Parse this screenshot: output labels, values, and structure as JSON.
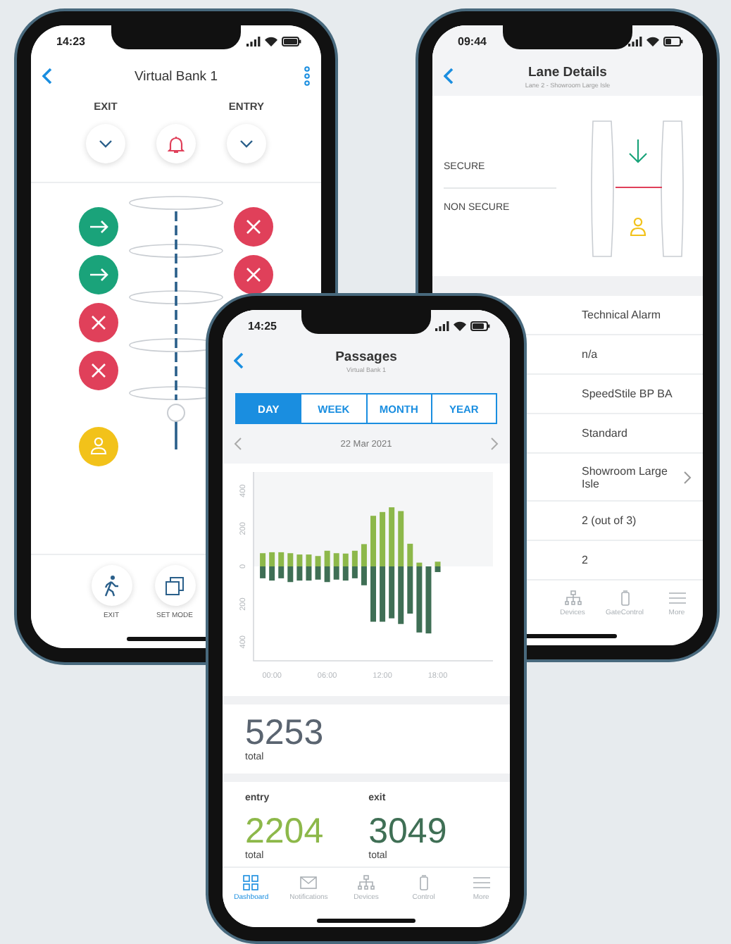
{
  "bank_screen": {
    "time": "14:23",
    "title": "Virtual Bank 1",
    "exit_label": "EXIT",
    "entry_label": "ENTRY",
    "exit_states": [
      {
        "kind": "pass"
      },
      {
        "kind": "pass"
      },
      {
        "kind": "blocked"
      },
      {
        "kind": "blocked"
      },
      {
        "kind": "person"
      }
    ],
    "entry_states": [
      {
        "kind": "blocked"
      },
      {
        "kind": "blocked"
      }
    ],
    "actions": [
      {
        "kind": "walk",
        "label": "EXIT"
      },
      {
        "kind": "mode",
        "label": "SET MODE"
      }
    ]
  },
  "lane_screen": {
    "time": "09:44",
    "title": "Lane Details",
    "subtitle": "Lane 2 - Showroom Large Isle",
    "zones": [
      "SECURE",
      "NON SECURE"
    ],
    "details": [
      {
        "kind": "text",
        "value": "Technical Alarm"
      },
      {
        "kind": "text",
        "value": "n/a"
      },
      {
        "kind": "text",
        "value": "SpeedStile BP BA"
      },
      {
        "kind": "text",
        "value": "Standard"
      },
      {
        "kind": "link",
        "value": "Showroom Large Isle"
      },
      {
        "kind": "text",
        "value": "2 (out of 3)"
      },
      {
        "kind": "text",
        "value": "2"
      }
    ],
    "tabs": [
      {
        "kind": "devices",
        "label": "Devices",
        "selected": false
      },
      {
        "kind": "gate",
        "label": "GateControl",
        "selected": false
      },
      {
        "kind": "more",
        "label": "More",
        "selected": false
      }
    ]
  },
  "passages_screen": {
    "time": "14:25",
    "title": "Passages",
    "subtitle": "Virtual Bank 1",
    "periods": [
      {
        "label": "DAY",
        "selected": true
      },
      {
        "label": "WEEK",
        "selected": false
      },
      {
        "label": "MONTH",
        "selected": false
      },
      {
        "label": "YEAR",
        "selected": false
      }
    ],
    "date": "22 Mar 2021",
    "chart_data": {
      "type": "bar",
      "stacked": true,
      "xlim": [
        -2,
        24
      ],
      "ylim": [
        -500,
        500
      ],
      "x": [
        -1,
        0,
        1,
        2,
        3,
        4,
        5,
        6,
        7,
        8,
        9,
        10,
        11,
        12,
        13,
        14,
        15,
        16,
        17,
        18
      ],
      "xticks": [
        {
          "value": 0,
          "label": "00:00"
        },
        {
          "value": 6,
          "label": "06:00"
        },
        {
          "value": 12,
          "label": "12:00"
        },
        {
          "value": 18,
          "label": "18:00"
        }
      ],
      "yticks": [
        {
          "value": 400,
          "label": "400"
        },
        {
          "value": 200,
          "label": "200"
        },
        0,
        {
          "value": -200,
          "label": "200"
        },
        {
          "value": -400,
          "label": "400"
        }
      ],
      "series": [
        {
          "name": "entry",
          "color": "#8db84a",
          "values": [
            70,
            75,
            75,
            70,
            63,
            63,
            55,
            83,
            70,
            68,
            83,
            118,
            268,
            288,
            313,
            293,
            120,
            20,
            0,
            25
          ]
        },
        {
          "name": "exit",
          "color": "#3f6f55",
          "values": [
            -63,
            -75,
            -63,
            -83,
            -75,
            -75,
            -70,
            -83,
            -70,
            -75,
            -63,
            -100,
            -293,
            -293,
            -275,
            -305,
            -250,
            -350,
            -355,
            -30
          ]
        }
      ]
    },
    "total": {
      "value": "5253",
      "label": "total"
    },
    "entry": {
      "value": "2204",
      "label": "total"
    },
    "exit": {
      "value": "3049",
      "label": "total"
    },
    "tabs": [
      {
        "kind": "dashboard",
        "label": "Dashboard",
        "selected": true
      },
      {
        "kind": "notifications",
        "label": "Notifications",
        "selected": false
      },
      {
        "kind": "devices",
        "label": "Devices",
        "selected": false
      },
      {
        "kind": "control",
        "label": "Control",
        "selected": false
      },
      {
        "kind": "more",
        "label": "More",
        "selected": false
      }
    ]
  }
}
